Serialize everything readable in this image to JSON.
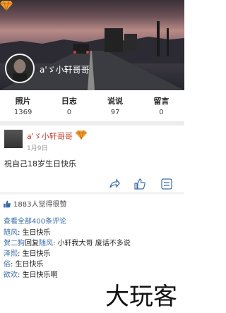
{
  "profile": {
    "name": "a'ゞ小轩哥哥",
    "gem_icon": "diamond-badge-icon"
  },
  "stats": [
    {
      "label": "照片",
      "value": "1369"
    },
    {
      "label": "日志",
      "value": "0"
    },
    {
      "label": "说说",
      "value": "97"
    },
    {
      "label": "留言",
      "value": "0"
    }
  ],
  "post": {
    "author": "a'ゞ小轩哥哥",
    "date": "1月9日",
    "text": "祝自己18岁生日快乐",
    "actions": [
      "share-icon",
      "like-icon",
      "more-icon"
    ]
  },
  "likes": {
    "text": "1883人觉得很赞"
  },
  "comments": {
    "view_all": "查看全部400条评论",
    "items": [
      {
        "user": "随风",
        "sep": ": ",
        "text": "生日快乐"
      },
      {
        "user": "贺二狗",
        "mid": "回复",
        "target": "随风",
        "sep": ": ",
        "text": "小轩我大哥 废话不多说"
      },
      {
        "user": "泽熙",
        "sep": ": ",
        "text": "生日快乐"
      },
      {
        "user": "俗",
        "sep": ": ",
        "text": "生日快乐"
      },
      {
        "user": "欲欢",
        "sep": ": ",
        "text": "生日快乐啊"
      }
    ]
  },
  "watermark": {
    "text": "大玩客"
  },
  "colors": {
    "link": "#3b6ca8",
    "author": "#c0392b",
    "gem": "#f0a030"
  }
}
